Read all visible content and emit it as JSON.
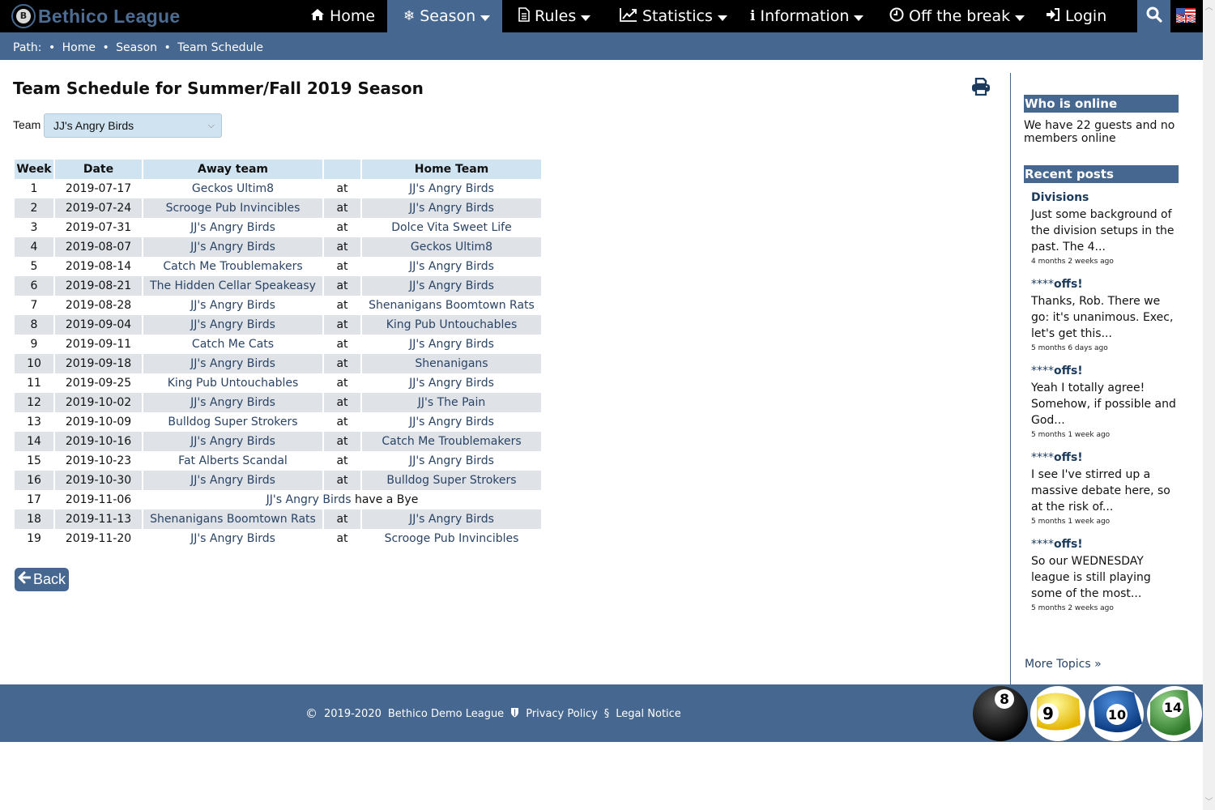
{
  "brand": {
    "logo_letter": "B",
    "name": "Bethico League"
  },
  "nav": {
    "items": [
      {
        "label": "Home",
        "icon": "home-icon",
        "dropdown": false,
        "active": false
      },
      {
        "label": "Season",
        "icon": "snowflake-icon",
        "dropdown": true,
        "active": true
      },
      {
        "label": "Rules",
        "icon": "document-icon",
        "dropdown": true,
        "active": false
      },
      {
        "label": "Statistics",
        "icon": "line-chart-icon",
        "dropdown": true,
        "active": false
      },
      {
        "label": "Information",
        "icon": "info-icon",
        "dropdown": true,
        "active": false
      },
      {
        "label": "Off the break",
        "icon": "clock-icon",
        "dropdown": true,
        "active": false
      },
      {
        "label": "Login",
        "icon": "login-icon",
        "dropdown": false,
        "active": false
      }
    ],
    "search_icon": "search-icon",
    "language_icon": "uk-us-flag-icon"
  },
  "breadcrumb": {
    "prefix": "Path:",
    "items": [
      "Home",
      "Season",
      "Team Schedule"
    ],
    "separator": "•"
  },
  "main": {
    "title": "Team Schedule for Summer/Fall 2019 Season",
    "team_label": "Team",
    "team_selected": "JJ's Angry Birds",
    "print_icon": "print-icon",
    "table": {
      "headers": [
        "Week",
        "Date",
        "Away team",
        "",
        "Home Team"
      ],
      "rows": [
        {
          "week": "1",
          "date": "2019-07-17",
          "away": "Geckos Ultim8",
          "at": "at",
          "home": "JJ's Angry Birds"
        },
        {
          "week": "2",
          "date": "2019-07-24",
          "away": "Scrooge Pub Invincibles",
          "at": "at",
          "home": "JJ's Angry Birds"
        },
        {
          "week": "3",
          "date": "2019-07-31",
          "away": "JJ's Angry Birds",
          "at": "at",
          "home": "Dolce Vita Sweet Life"
        },
        {
          "week": "4",
          "date": "2019-08-07",
          "away": "JJ's Angry Birds",
          "at": "at",
          "home": "Geckos Ultim8"
        },
        {
          "week": "5",
          "date": "2019-08-14",
          "away": "Catch Me Troublemakers",
          "at": "at",
          "home": "JJ's Angry Birds"
        },
        {
          "week": "6",
          "date": "2019-08-21",
          "away": "The Hidden Cellar Speakeasy",
          "at": "at",
          "home": "JJ's Angry Birds"
        },
        {
          "week": "7",
          "date": "2019-08-28",
          "away": "JJ's Angry Birds",
          "at": "at",
          "home": "Shenanigans Boomtown Rats"
        },
        {
          "week": "8",
          "date": "2019-09-04",
          "away": "JJ's Angry Birds",
          "at": "at",
          "home": "King Pub Untouchables"
        },
        {
          "week": "9",
          "date": "2019-09-11",
          "away": "Catch Me Cats",
          "at": "at",
          "home": "JJ's Angry Birds"
        },
        {
          "week": "10",
          "date": "2019-09-18",
          "away": "JJ's Angry Birds",
          "at": "at",
          "home": "Shenanigans"
        },
        {
          "week": "11",
          "date": "2019-09-25",
          "away": "King Pub Untouchables",
          "at": "at",
          "home": "JJ's Angry Birds"
        },
        {
          "week": "12",
          "date": "2019-10-02",
          "away": "JJ's Angry Birds",
          "at": "at",
          "home": "JJ's The Pain"
        },
        {
          "week": "13",
          "date": "2019-10-09",
          "away": "Bulldog Super Strokers",
          "at": "at",
          "home": "JJ's Angry Birds"
        },
        {
          "week": "14",
          "date": "2019-10-16",
          "away": "JJ's Angry Birds",
          "at": "at",
          "home": "Catch Me Troublemakers"
        },
        {
          "week": "15",
          "date": "2019-10-23",
          "away": "Fat Alberts Scandal",
          "at": "at",
          "home": "JJ's Angry Birds"
        },
        {
          "week": "16",
          "date": "2019-10-30",
          "away": "JJ's Angry Birds",
          "at": "at",
          "home": "Bulldog Super Strokers"
        },
        {
          "week": "17",
          "date": "2019-11-06",
          "bye_team": "JJ's Angry Birds",
          "bye_text": " have a Bye"
        },
        {
          "week": "18",
          "date": "2019-11-13",
          "away": "Shenanigans Boomtown Rats",
          "at": "at",
          "home": "JJ's Angry Birds"
        },
        {
          "week": "19",
          "date": "2019-11-20",
          "away": "JJ's Angry Birds",
          "at": "at",
          "home": "Scrooge Pub Invincibles"
        }
      ]
    },
    "back_label": "Back"
  },
  "sidebar": {
    "online": {
      "title": "Who is online",
      "text": "We have 22 guests and no members online"
    },
    "recent": {
      "title": "Recent posts",
      "posts": [
        {
          "stars": "",
          "title": "Divisions",
          "text": "Just some background of the division setups in the past. The 4...",
          "time": "4 months 2 weeks ago"
        },
        {
          "stars": "****",
          "title": "offs!",
          "text": "Thanks, Rob. There we go: it's unanimous. Exec, let's get this...",
          "time": "5 months 6 days ago"
        },
        {
          "stars": "****",
          "title": "offs!",
          "text": "Yeah I totally agree! Somehow, if possible and God...",
          "time": "5 months 1 week ago"
        },
        {
          "stars": "****",
          "title": "offs!",
          "text": "I see I've stirred up a massive debate here, so at the risk of...",
          "time": "5 months 1 week ago"
        },
        {
          "stars": "****",
          "title": "offs!",
          "text": "So our WEDNESDAY league is still playing some of the most...",
          "time": "5 months 2 weeks ago"
        }
      ],
      "more_label": "More Topics »"
    }
  },
  "footer": {
    "copyright_symbol": "©",
    "years": "2019-2020",
    "org": "Bethico Demo League",
    "privacy_label": "Privacy Policy",
    "legal_symbol": "§",
    "legal_label": "Legal Notice",
    "balls": [
      "8",
      "9",
      "10",
      "14"
    ]
  },
  "colors": {
    "brand_blue": "#46678f",
    "nav_bg": "#000000",
    "table_header": "#cfe3f1",
    "row_alt": "#dfe2e7",
    "link": "#2a4466"
  }
}
